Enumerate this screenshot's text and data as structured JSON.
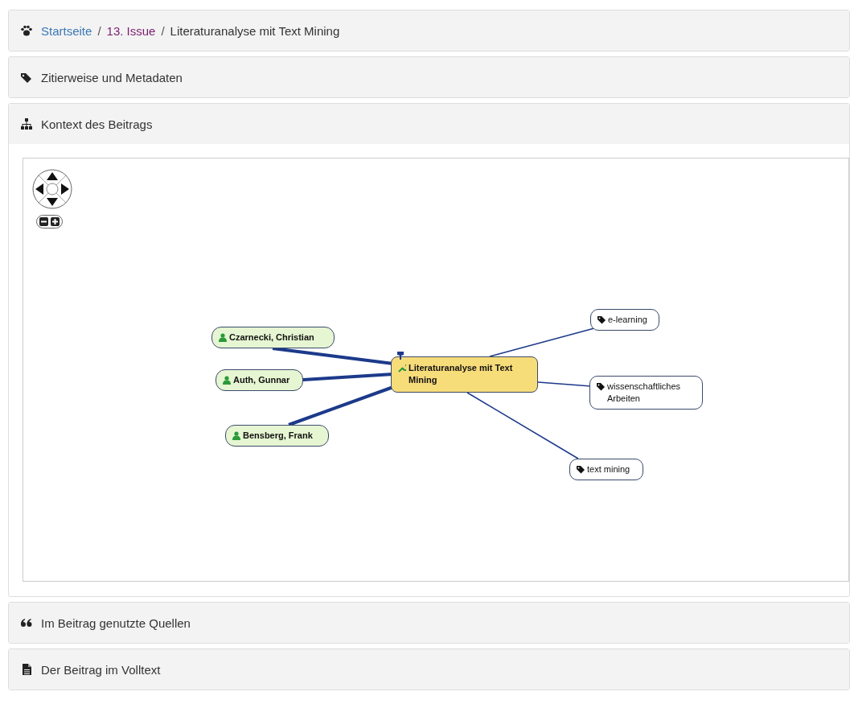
{
  "breadcrumb": [
    {
      "label": "Startseite",
      "kind": "link"
    },
    {
      "separator": "/",
      "label": "13. Issue",
      "kind": "visited"
    },
    {
      "separator": "/",
      "label": "Literaturanalyse mit Text Mining",
      "kind": "current"
    }
  ],
  "sections": [
    {
      "title": "Zitierweise und Metadaten",
      "expanded": false
    },
    {
      "title": "Kontext des Beitrags",
      "expanded": true
    },
    {
      "title": "Im Beitrag genutzte Quellen",
      "expanded": false
    },
    {
      "title": "Der Beitrag im Volltext",
      "expanded": false
    }
  ],
  "graph": {
    "center": "Literaturanalyse mit Text Mining",
    "authors": [
      "Czarnecki, Christian",
      "Auth, Gunnar",
      "Bensberg, Frank"
    ],
    "keywords": [
      "e-learning",
      "wissenschaftliches Arbeiten",
      "text mining"
    ]
  }
}
